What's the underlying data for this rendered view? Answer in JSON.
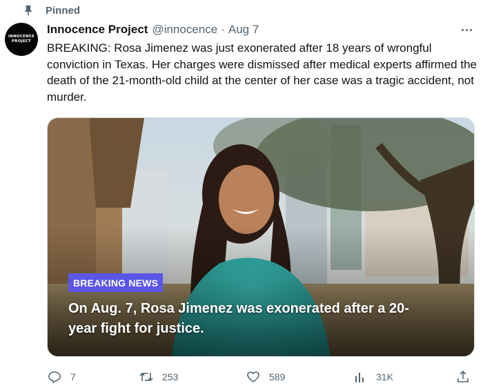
{
  "pinned": {
    "label": "Pinned",
    "icon": "pin-icon"
  },
  "author": {
    "display_name": "Innocence Project",
    "handle": "@innocence",
    "separator": "·",
    "date": "Aug 7",
    "avatar_text_line1": "INNOCENCE",
    "avatar_text_line2": "PROJECT"
  },
  "tweet": {
    "text": "BREAKING: Rosa Jimenez was just exonerated after 18 years of wrongful conviction in Texas. Her charges were dismissed after medical experts affirmed the death of the 21-month-old child at the center of her case was a tragic accident, not murder."
  },
  "media": {
    "badge": "BREAKING NEWS",
    "caption": "On Aug. 7, Rosa Jimenez was exonerated after a 20-year fight for justice.",
    "badge_color": "#5b55e8"
  },
  "actions": {
    "replies": "7",
    "retweets": "253",
    "likes": "589",
    "views": "31K"
  },
  "colors": {
    "text": "#0f1419",
    "muted": "#536471"
  }
}
